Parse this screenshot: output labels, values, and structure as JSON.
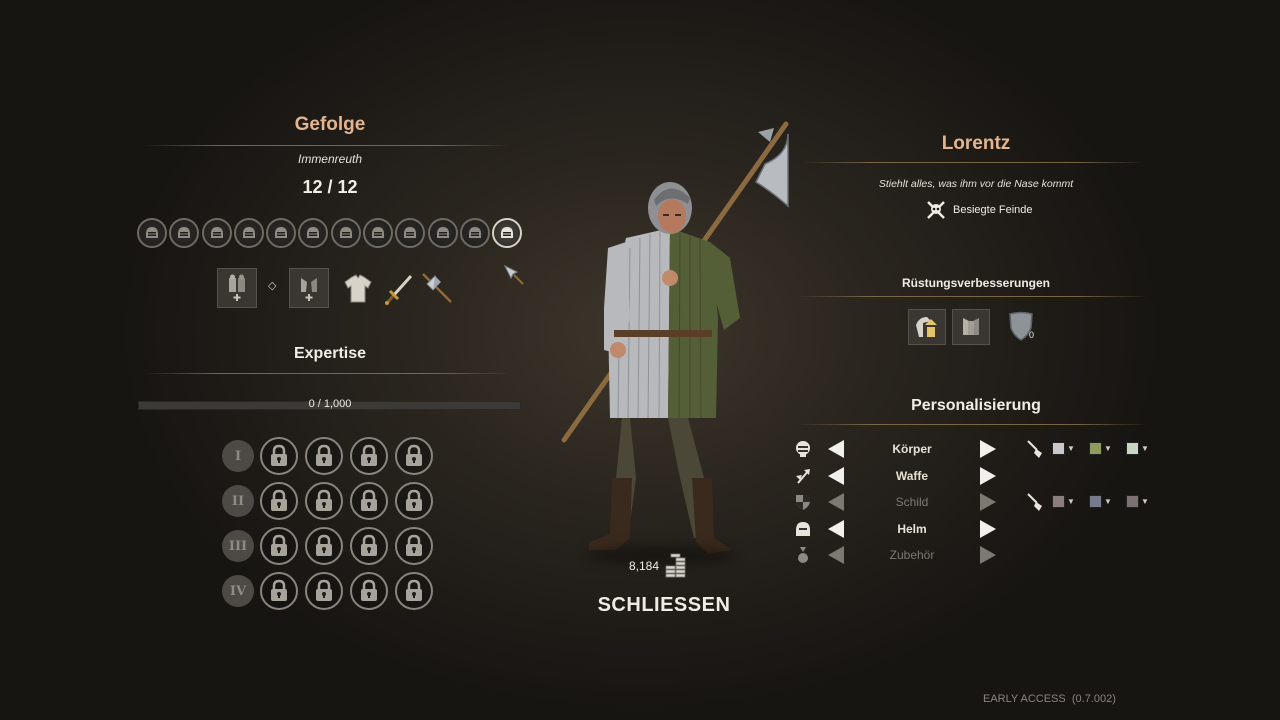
{
  "left": {
    "title": "Gefolge",
    "subtitle": "Immenreuth",
    "count": "12 / 12",
    "tokens": 12,
    "active_token": 11,
    "equipment": {
      "separator": "◇",
      "icons": [
        "troop-upgrade-icon",
        "troop-upgrade-icon",
        "tunic-icon",
        "sword-icon",
        "axe-icon"
      ]
    },
    "expertise": {
      "title": "Expertise",
      "progress_text": "0 / 1,000",
      "progress": 0,
      "tiers": [
        "I",
        "II",
        "III",
        "IV"
      ]
    }
  },
  "center": {
    "gold": "8,184",
    "close_label": "SCHLIESSEN"
  },
  "right": {
    "title": "Lorentz",
    "description": "Stiehlt alles, was ihm vor die Nase kommt",
    "trait": "Besiegte Feinde",
    "armor_upgrades": {
      "title": "Rüstungsverbesserungen",
      "shield_count": "0"
    },
    "personalization": {
      "title": "Personalisierung",
      "rows": [
        {
          "label": "Körper",
          "enabled": true
        },
        {
          "label": "Waffe",
          "enabled": true
        },
        {
          "label": "Schild",
          "enabled": false
        },
        {
          "label": "Helm",
          "enabled": true
        },
        {
          "label": "Zubehör",
          "enabled": false
        }
      ],
      "body_colors": [
        "#c9c9c9",
        "#8f9a5c",
        "#c9d6c4"
      ],
      "shield_colors": [
        "#8d7d7c",
        "#767a8c",
        "#7d7272"
      ]
    }
  },
  "footer": {
    "version": "EARLY ACCESS  (0.7.002)"
  }
}
